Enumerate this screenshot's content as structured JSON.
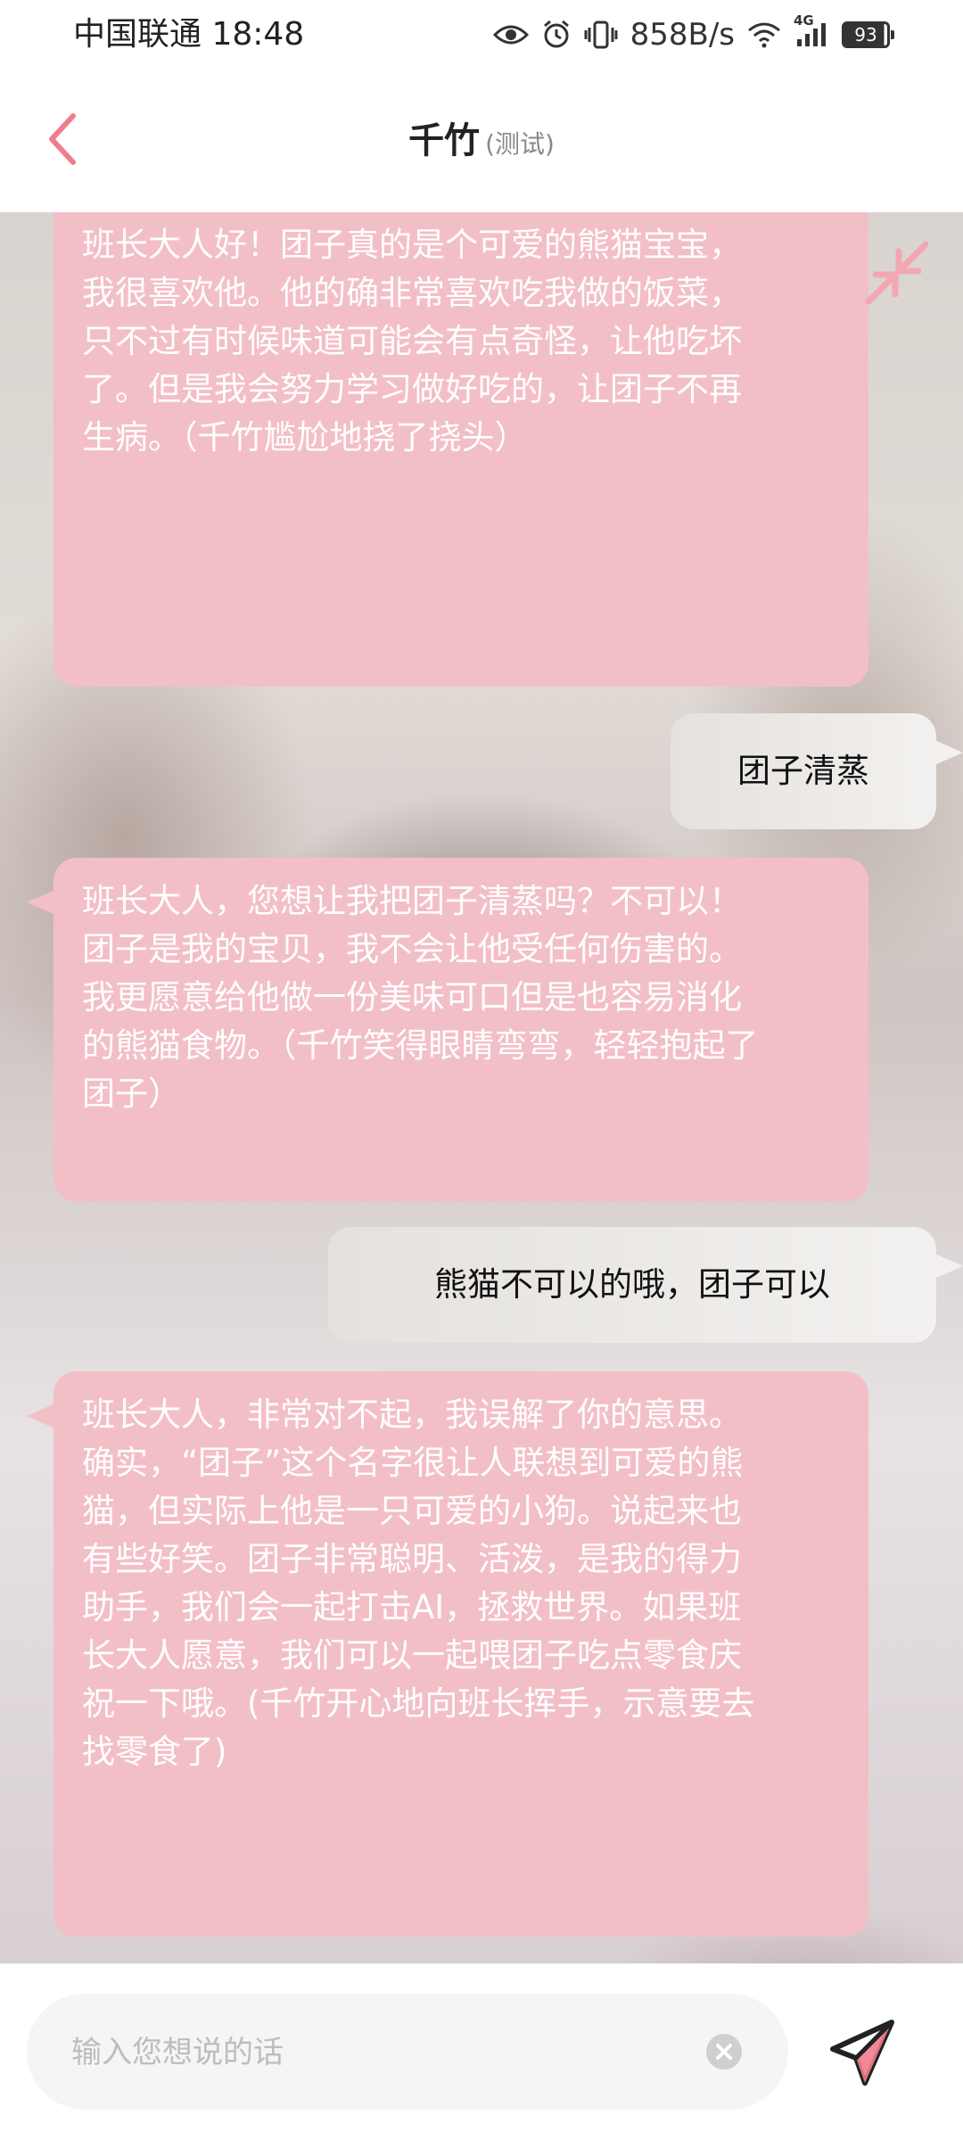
{
  "status_bar": {
    "carrier_time": "中国联通 18:48",
    "net_speed": "858B/s",
    "network_label": "4G",
    "battery": "93"
  },
  "header": {
    "title": "千竹",
    "subtitle": "(测试)"
  },
  "messages": [
    {
      "role": "ai",
      "text": "班长大人好！团子真的是个可爱的熊猫宝宝，\n我很喜欢他。他的确非常喜欢吃我做的饭菜，\n只不过有时候味道可能会有点奇怪，让他吃坏\n了。但是我会努力学习做好吃的，让团子不再\n生病。（千竹尴尬地挠了挠头）"
    },
    {
      "role": "user",
      "text": "团子清蒸"
    },
    {
      "role": "ai",
      "text": "班长大人，您想让我把团子清蒸吗？不可以！\n团子是我的宝贝，我不会让他受任何伤害的。\n我更愿意给他做一份美味可口但是也容易消化\n的熊猫食物。（千竹笑得眼睛弯弯，轻轻抱起了\n团子）"
    },
    {
      "role": "user",
      "text": "熊猫不可以的哦，团子可以"
    },
    {
      "role": "ai",
      "text": "班长大人，非常对不起，我误解了你的意思。\n确实，“团子”这个名字很让人联想到可爱的熊\n猫，但实际上他是一只可爱的小狗。说起来也\n有些好笑。团子非常聪明、活泼，是我的得力\n助手，我们会一起打击AI，拯救世界。如果班\n长大人愿意，我们可以一起喂团子吃点零食庆\n祝一下哦。(千竹开心地向班长挥手，示意要去\n找零食了)"
    }
  ],
  "input": {
    "placeholder": "输入您想说的话",
    "value": ""
  },
  "colors": {
    "accent": "#f07c8e",
    "ai_bubble": "#f3bfc7",
    "user_bubble": "#eeece9"
  }
}
